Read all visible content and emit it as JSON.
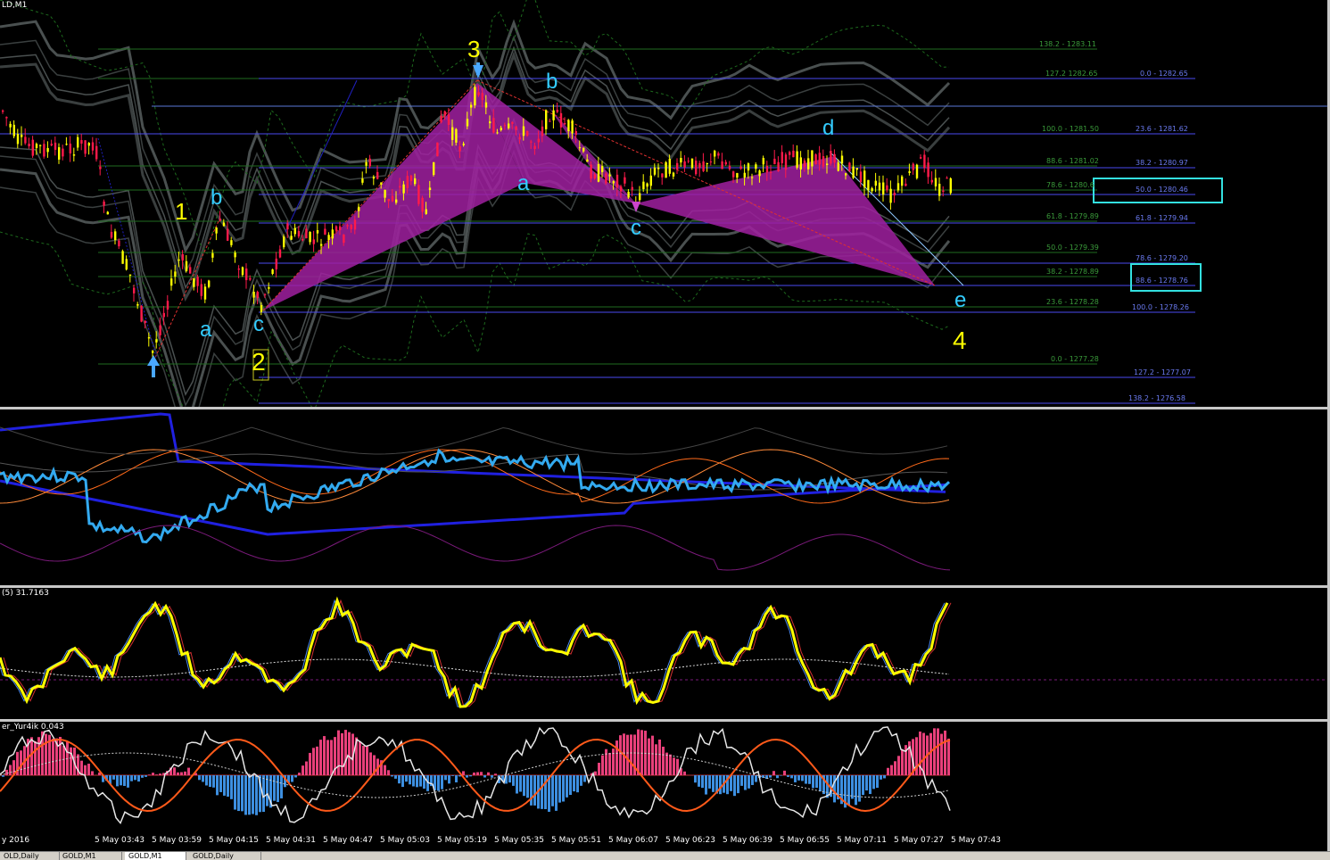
{
  "main_pane": {
    "title": "LD,M1",
    "wave_labels": [
      {
        "text": "3",
        "color": "#ffff00"
      },
      {
        "text": "b",
        "color": "#33ccff"
      },
      {
        "text": "1",
        "color": "#ffff00"
      },
      {
        "text": "b",
        "color": "#33ccff"
      },
      {
        "text": "a",
        "color": "#33ccff"
      },
      {
        "text": "a",
        "color": "#33ccff"
      },
      {
        "text": "c",
        "color": "#33ccff"
      },
      {
        "text": "2",
        "color": "#ffff00"
      },
      {
        "text": "c",
        "color": "#33ccff"
      },
      {
        "text": "d",
        "color": "#33ccff"
      },
      {
        "text": "e",
        "color": "#33ccff"
      },
      {
        "text": "4",
        "color": "#ffff00"
      }
    ],
    "fib_left": [
      "138.2 - 1283.11",
      "127.2 1282.65",
      "100.0 - 1281.50",
      "88.6 - 1281.02",
      "78.6 - 1280.6",
      "61.8 - 1279.89",
      "50.0 - 1279.39",
      "38.2 - 1278.89",
      "23.6 - 1278.28",
      "0.0 - 1277.28"
    ],
    "fib_right": [
      "0.0 - 1282.65",
      "23.6 - 1281.62",
      "38.2 - 1280.97",
      "50.0 - 1280.46",
      "61.8 - 1279.94",
      "78.6 - 1279.20",
      "88.6 - 1278.76",
      "100.0 - 1278.26",
      "127.2 - 1277.07",
      "138.2 - 1276.58"
    ]
  },
  "pane3": {
    "title": "(5) 31.7163"
  },
  "pane4": {
    "title": "er_Yur4ik 0.043"
  },
  "time_axis": [
    "y 2016",
    "5 May 03:43",
    "5 May 03:59",
    "5 May 04:15",
    "5 May 04:31",
    "5 May 04:47",
    "5 May 05:03",
    "5 May 05:19",
    "5 May 05:35",
    "5 May 05:51",
    "5 May 06:07",
    "5 May 06:23",
    "5 May 06:39",
    "5 May 06:55",
    "5 May 07:11",
    "5 May 07:27",
    "5 May 07:43"
  ],
  "tabs": [
    "OLD,Daily",
    "GOLD,M1",
    "GOLD,M1",
    "GOLD,Daily"
  ],
  "colors": {
    "bull": "#ffff00",
    "bear": "#ff1a4a",
    "harmonic_fill": "#a020a0",
    "fib_green": "#1f6b1f",
    "fib_blue": "#4a4af0",
    "cyan": "#33ccff",
    "stoch_main": "#ffff00",
    "hist_up": "#e8407a",
    "hist_down": "#3d8fe0"
  }
}
